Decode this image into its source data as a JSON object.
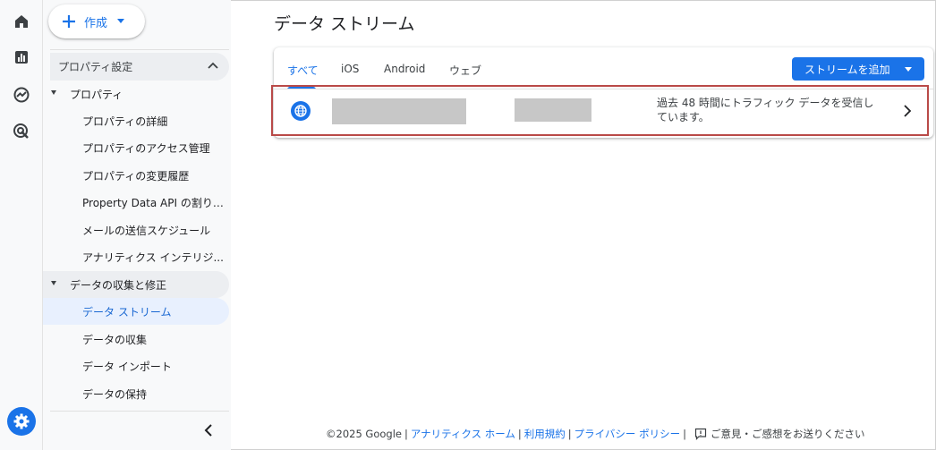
{
  "create_button": {
    "label": "作成"
  },
  "sidebar": {
    "section_title": "プロパティ設定",
    "groups": [
      {
        "label": "プロパティ",
        "items": [
          "プロパティの詳細",
          "プロパティのアクセス管理",
          "プロパティの変更履歴",
          "Property Data API の割り当...",
          "メールの送信スケジュール",
          "アナリティクス インテリジ..."
        ]
      },
      {
        "label": "データの収集と修正",
        "items": [
          "データ ストリーム",
          "データの収集",
          "データ インポート",
          "データの保持"
        ]
      }
    ],
    "active_item": "データ ストリーム"
  },
  "main": {
    "title": "データ ストリーム",
    "tabs": [
      "すべて",
      "iOS",
      "Android",
      "ウェブ"
    ],
    "active_tab": "すべて",
    "add_stream_button": "ストリームを追加",
    "stream": {
      "icon": "globe-icon",
      "status": "過去 48 時間にトラフィック データを受信しています。"
    }
  },
  "footer": {
    "copyright": "©2025 Google",
    "links": [
      "アナリティクス ホーム",
      "利用規約",
      "プライバシー ポリシー"
    ],
    "feedback": "ご意見・ご感想をお送りください"
  },
  "colors": {
    "accent": "#1a73e8",
    "highlight_border": "#b94a48",
    "active_nav_bg": "#e8f0fe"
  }
}
